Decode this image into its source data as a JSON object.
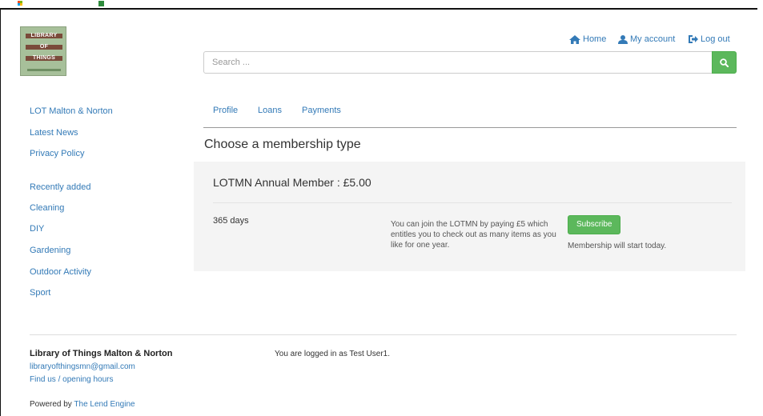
{
  "brand": {
    "logo_lines": [
      "LIBRARY",
      "OF",
      "THINGS"
    ]
  },
  "topnav": {
    "home": "Home",
    "account": "My account",
    "logout": "Log out"
  },
  "search": {
    "placeholder": "Search ..."
  },
  "sidebar": {
    "pages": [
      "LOT Malton & Norton",
      "Latest News",
      "Privacy Policy"
    ],
    "categories": [
      "Recently added",
      "Cleaning",
      "DIY",
      "Gardening",
      "Outdoor Activity",
      "Sport"
    ]
  },
  "tabs": [
    "Profile",
    "Loans",
    "Payments"
  ],
  "main": {
    "heading": "Choose a membership type",
    "membership": {
      "title": "LOTMN Annual Member : £5.00",
      "duration": "365 days",
      "description": "You can join the LOTMN by paying £5 which entitles you to check out as many items as you like for one year.",
      "subscribe_label": "Subscribe",
      "start_note": "Membership will start today."
    }
  },
  "footer": {
    "org_name": "Library of Things Malton & Norton",
    "email": "libraryofthingsmn@gmail.com",
    "find_us": "Find us / opening hours",
    "logged_in": "You are logged in as Test User1.",
    "powered_prefix": "Powered by ",
    "powered_link": "The Lend Engine"
  },
  "colors": {
    "link": "#337ab7",
    "accent_green": "#5cb85c",
    "panel_bg": "#f4f4f4"
  }
}
